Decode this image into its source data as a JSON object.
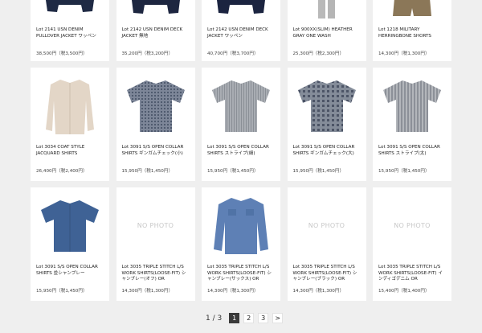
{
  "products": [
    {
      "title": "Lot 2141 USN DENIM\nPULLOVER JACKET ワッペン",
      "price": "38,500円（税3,500円）",
      "image": "navy-jacket",
      "photo": true
    },
    {
      "title": "Lot 2142 USN DENIM DECK\nJACKET 無地",
      "price": "35,200円（税3,200円）",
      "image": "navy-jacket",
      "photo": true
    },
    {
      "title": "Lot 2142 USN DENIM DECK\nJACKET ワッペン",
      "price": "40,700円（税3,700円）",
      "image": "navy-jacket",
      "photo": true
    },
    {
      "title": "Lot 900XX(SLIM) HEATHER\nGRAY ONE WASH",
      "price": "25,300円（税2,300円）",
      "image": "gray-jeans",
      "photo": true
    },
    {
      "title": "Lot 1218 MILITARY\nHERRINGBONE SHORTS",
      "price": "14,300円（税1,300円）",
      "image": "olive-shorts",
      "photo": true
    },
    {
      "title": "Lot 3034 COAT STYLE\nJACQUARD SHIRTS",
      "price": "26,400円（税2,400円）",
      "image": "beige-shirt",
      "photo": true
    },
    {
      "title": "Lot 3091 S/S OPEN COLLAR\nSHIRTS ギンガムチェック(小)",
      "price": "15,950円（税1,450円）",
      "image": "gingham-small-shirt",
      "photo": true
    },
    {
      "title": "Lot 3091 S/S OPEN COLLAR\nSHIRTS ストライプ(細)",
      "price": "15,950円（税1,450円）",
      "image": "thin-stripe-shirt",
      "photo": true
    },
    {
      "title": "Lot 3091 S/S OPEN COLLAR\nSHIRTS ギンガムチェック(大)",
      "price": "15,950円（税1,450円）",
      "image": "gingham-large-shirt",
      "photo": true
    },
    {
      "title": "Lot 3091 S/S OPEN COLLAR\nSHIRTS ストライプ(太)",
      "price": "15,950円（税1,450円）",
      "image": "wide-stripe-shirt",
      "photo": true
    },
    {
      "title": "Lot 3091 S/S OPEN COLLAR\nSHIRTS 並シャンブレー",
      "price": "15,950円（税1,450円）",
      "image": "blue-chambray-ss-shirt",
      "photo": true
    },
    {
      "title": "Lot 3035 TRIPLE STITCH L/S\nWORK SHIRTS(LOOSE-FIT) シ\nャンブレー(オフ) OR",
      "price": "14,300円（税1,300円）",
      "image": "",
      "photo": false
    },
    {
      "title": "Lot 3035 TRIPLE STITCH L/S\nWORK SHIRTS(LOOSE-FIT) シ\nャンブレー(サックス) OR",
      "price": "14,300円（税1,300円）",
      "image": "blue-work-shirt",
      "photo": true
    },
    {
      "title": "Lot 3035 TRIPLE STITCH L/S\nWORK SHIRTS(LOOSE-FIT) シ\nャンブレー(ブラック) OR",
      "price": "14,300円（税1,300円）",
      "image": "",
      "photo": false
    },
    {
      "title": "Lot 3035 TRIPLE STITCH L/S\nWORK SHIRTS(LOOSE-FIT) イ\nンディゴデニム OR",
      "price": "15,400円（税1,400円）",
      "image": "",
      "photo": false
    }
  ],
  "no_photo_label": "NO PHOTO",
  "pagination": {
    "count_label": "1 / 3",
    "pages": [
      "1",
      "2",
      "3"
    ],
    "current": "1",
    "next_label": ">"
  }
}
